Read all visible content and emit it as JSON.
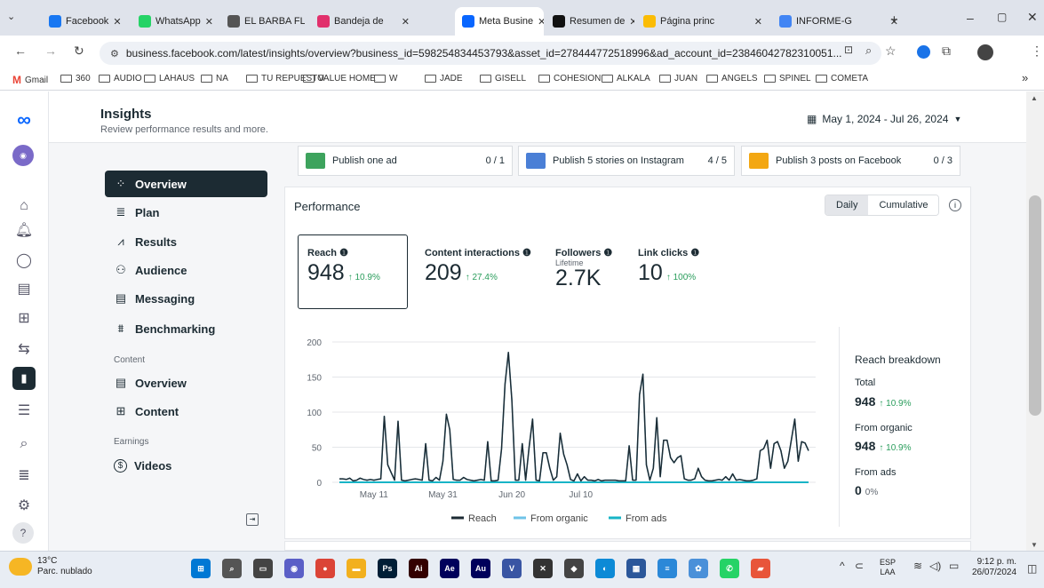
{
  "browser": {
    "tabs": [
      {
        "title": "Facebook",
        "favicon": "facebook-icon",
        "color": "#1877f2",
        "active": false
      },
      {
        "title": "WhatsApp",
        "favicon": "whatsapp-icon",
        "color": "#25d366",
        "active": false
      },
      {
        "title": "EL BARBA FL",
        "favicon": "generic-site-icon",
        "color": "#555555",
        "active": false
      },
      {
        "title": "Bandeja de",
        "favicon": "instagram-icon",
        "color": "#e1306c",
        "active": false
      },
      {
        "title": "Meta Busine",
        "favicon": "meta-icon",
        "color": "#0866ff",
        "active": true
      },
      {
        "title": "Resumen de",
        "favicon": "wix-icon",
        "color": "#111111",
        "active": false
      },
      {
        "title": "Página princ",
        "favicon": "google-drive-icon",
        "color": "#fbbc04",
        "active": false
      },
      {
        "title": "INFORME-G",
        "favicon": "google-docs-icon",
        "color": "#4285f4",
        "active": false
      }
    ],
    "new_tab": "+",
    "url": "business.facebook.com/latest/insights/overview?business_id=598254834453793&asset_id=278444772518996&ad_account_id=23846042782310051...",
    "bookmarks": [
      "Gmail",
      "360",
      "AUDIO",
      "LAHAUS",
      "NA",
      "TU REPUESTO",
      "VALUE HOME",
      "W",
      "JADE",
      "GISELL",
      "COHESION",
      "ALKALA",
      "JUAN",
      "ANGELS",
      "SPINEL",
      "COMETA"
    ],
    "bookmarks_more": "»"
  },
  "header": {
    "title": "Insights",
    "subtitle": "Review performance results and more.",
    "date_range": "May 1, 2024 - Jul 26, 2024"
  },
  "nav": {
    "items": [
      {
        "label": "Overview",
        "icon": "overview-icon",
        "glyph": "⁘",
        "selected": true
      },
      {
        "label": "Plan",
        "icon": "plan-icon",
        "glyph": "≣",
        "selected": false
      },
      {
        "label": "Results",
        "icon": "results-icon",
        "glyph": "⩘",
        "selected": false
      },
      {
        "label": "Audience",
        "icon": "audience-icon",
        "glyph": "⚇",
        "selected": false
      },
      {
        "label": "Messaging",
        "icon": "messaging-icon",
        "glyph": "▤",
        "selected": false
      }
    ],
    "benchmarking": {
      "label": "Benchmarking",
      "glyph": "⩩"
    },
    "content_section": "Content",
    "content_items": [
      {
        "label": "Overview",
        "glyph": "▤"
      },
      {
        "label": "Content",
        "glyph": "⊞"
      }
    ],
    "earnings_section": "Earnings",
    "earnings_items": [
      {
        "label": "Videos",
        "glyph": "$"
      }
    ]
  },
  "tasks": [
    {
      "label": "Publish one ad",
      "count": "0 / 1",
      "color": "#3da35d"
    },
    {
      "label": "Publish 5 stories on Instagram",
      "count": "4 / 5",
      "color": "#4a7fd6"
    },
    {
      "label": "Publish 3 posts on Facebook",
      "count": "0 / 3",
      "color": "#f3a712"
    }
  ],
  "performance": {
    "title": "Performance",
    "toggle": [
      "Daily",
      "Cumulative"
    ],
    "metrics": [
      {
        "label": "Reach",
        "value": "948",
        "change": "↑ 10.9%"
      },
      {
        "label": "Content interactions",
        "value": "209",
        "change": "↑ 27.4%"
      },
      {
        "label": "Followers",
        "sub": "Lifetime",
        "value": "2.7K"
      },
      {
        "label": "Link clicks",
        "value": "10",
        "change": "↑ 100%"
      }
    ],
    "breakdown": {
      "title": "Reach breakdown",
      "total_label": "Total",
      "total_value": "948",
      "total_change": "↑ 10.9%",
      "organic_label": "From organic",
      "organic_value": "948",
      "organic_change": "↑ 10.9%",
      "ads_label": "From ads",
      "ads_value": "0",
      "ads_change": "0%"
    }
  },
  "chart_data": {
    "type": "line",
    "x_ticks": [
      "May 11",
      "May 31",
      "Jun 20",
      "Jul 10"
    ],
    "ylim": [
      0,
      200
    ],
    "y_ticks": [
      0,
      50,
      100,
      150,
      200
    ],
    "legend": [
      "Reach",
      "From organic",
      "From ads"
    ],
    "legend_colors": [
      "#1c2b33",
      "#6fc3e8",
      "#18b4c6"
    ],
    "series": [
      {
        "name": "Reach",
        "values": [
          5,
          5,
          4,
          6,
          2,
          3,
          6,
          4,
          3,
          4,
          3,
          4,
          5,
          94,
          25,
          14,
          3,
          87,
          3,
          2,
          3,
          4,
          5,
          4,
          3,
          55,
          3,
          2,
          7,
          3,
          30,
          97,
          75,
          4,
          3,
          3,
          7,
          4,
          3,
          2,
          3,
          4,
          3,
          58,
          2,
          2,
          3,
          48,
          140,
          185,
          117,
          3,
          3,
          55,
          3,
          50,
          90,
          3,
          2,
          42,
          42,
          20,
          3,
          8,
          70,
          40,
          25,
          4,
          2,
          12,
          2,
          8,
          3,
          3,
          2,
          4,
          2,
          3,
          3,
          3,
          3,
          2,
          2,
          2,
          52,
          3,
          3,
          125,
          154,
          25,
          3,
          20,
          92,
          8,
          60,
          60,
          35,
          28,
          35,
          38,
          5,
          3,
          3,
          5,
          20,
          8,
          3,
          2,
          2,
          3,
          4,
          3,
          8,
          3,
          12,
          3,
          4,
          3,
          2,
          2,
          3,
          5,
          45,
          48,
          60,
          20,
          55,
          58,
          45,
          20,
          30,
          60,
          90,
          30,
          58,
          56,
          45
        ]
      },
      {
        "name": "From organic",
        "values": [
          5,
          5,
          4,
          6,
          2,
          3,
          6,
          4,
          3,
          4,
          3,
          4,
          5,
          94,
          25,
          14,
          3,
          87,
          3,
          2,
          3,
          4,
          5,
          4,
          3,
          55,
          3,
          2,
          7,
          3,
          30,
          97,
          75,
          4,
          3,
          3,
          7,
          4,
          3,
          2,
          3,
          4,
          3,
          58,
          2,
          2,
          3,
          48,
          140,
          185,
          117,
          3,
          3,
          55,
          3,
          50,
          90,
          3,
          2,
          42,
          42,
          20,
          3,
          8,
          70,
          40,
          25,
          4,
          2,
          12,
          2,
          8,
          3,
          3,
          2,
          4,
          2,
          3,
          3,
          3,
          3,
          2,
          2,
          2,
          52,
          3,
          3,
          125,
          154,
          25,
          3,
          20,
          92,
          8,
          60,
          60,
          35,
          28,
          35,
          38,
          5,
          3,
          3,
          5,
          20,
          8,
          3,
          2,
          2,
          3,
          4,
          3,
          8,
          3,
          12,
          3,
          4,
          3,
          2,
          2,
          3,
          5,
          45,
          48,
          60,
          20,
          55,
          58,
          45,
          20,
          30,
          60,
          90,
          30,
          58,
          56,
          45
        ]
      },
      {
        "name": "From ads",
        "values": [
          0,
          0,
          0,
          0,
          0,
          0,
          0,
          0,
          0,
          0,
          0,
          0,
          0,
          0,
          0,
          0,
          0,
          0,
          0,
          0,
          0,
          0,
          0,
          0,
          0,
          0,
          0,
          0,
          0,
          0,
          0,
          0,
          0,
          0,
          0,
          0,
          0,
          0,
          0,
          0,
          0,
          0,
          0,
          0,
          0,
          0,
          0,
          0,
          0,
          0,
          0,
          0,
          0,
          0,
          0,
          0,
          0,
          0,
          0,
          0,
          0,
          0,
          0,
          0,
          0,
          0,
          0,
          0,
          0,
          0,
          0,
          0,
          0,
          0,
          0,
          0,
          0,
          0,
          0,
          0,
          0,
          0,
          0,
          0,
          0,
          0,
          0,
          0,
          0,
          0,
          0,
          0,
          0,
          0,
          0,
          0,
          0,
          0,
          0,
          0,
          0,
          0,
          0,
          0,
          0,
          0,
          0,
          0,
          0,
          0,
          0,
          0,
          0,
          0,
          0,
          0,
          0,
          0,
          0,
          0,
          0,
          0,
          0,
          0,
          0,
          0,
          0,
          0,
          0,
          0,
          0,
          0,
          0,
          0,
          0,
          0,
          0
        ]
      }
    ]
  },
  "taskbar": {
    "weather_temp": "13°C",
    "weather_desc": "Parc. nublado",
    "lang": "ESP",
    "lang2": "LAA",
    "time": "9:12 p. m.",
    "date": "26/07/2024",
    "apps": [
      {
        "icon": "windows-start-icon",
        "glyph": "⊞",
        "color": "#0078d4"
      },
      {
        "icon": "search-icon",
        "glyph": "⌕",
        "color": "#555555"
      },
      {
        "icon": "task-view-icon",
        "glyph": "▭",
        "color": "#444444"
      },
      {
        "icon": "chat-icon",
        "glyph": "◉",
        "color": "#5b5fc7"
      },
      {
        "icon": "chrome-icon",
        "glyph": "●",
        "color": "#db4437"
      },
      {
        "icon": "file-explorer-icon",
        "glyph": "▬",
        "color": "#f2b01e"
      },
      {
        "icon": "photoshop-icon",
        "glyph": "Ps",
        "color": "#001e36"
      },
      {
        "icon": "illustrator-icon",
        "glyph": "Ai",
        "color": "#330000"
      },
      {
        "icon": "after-effects-icon",
        "glyph": "Ae",
        "color": "#00005b"
      },
      {
        "icon": "audition-icon",
        "glyph": "Au",
        "color": "#00005b"
      },
      {
        "icon": "visio-icon",
        "glyph": "V",
        "color": "#3955a3"
      },
      {
        "icon": "capcut-icon",
        "glyph": "✕",
        "color": "#333333"
      },
      {
        "icon": "inkscape-icon",
        "glyph": "◆",
        "color": "#444444"
      },
      {
        "icon": "edge-icon",
        "glyph": "◐",
        "color": "#0c8ad6"
      },
      {
        "icon": "calculator-icon",
        "glyph": "▦",
        "color": "#2b579a"
      },
      {
        "icon": "notepad-icon",
        "glyph": "≡",
        "color": "#2b88d8"
      },
      {
        "icon": "photos-icon",
        "glyph": "✿",
        "color": "#4a90d9"
      },
      {
        "icon": "whatsapp-icon",
        "glyph": "✆",
        "color": "#25d366"
      },
      {
        "icon": "paint-icon",
        "glyph": "▰",
        "color": "#e8553a"
      }
    ]
  }
}
